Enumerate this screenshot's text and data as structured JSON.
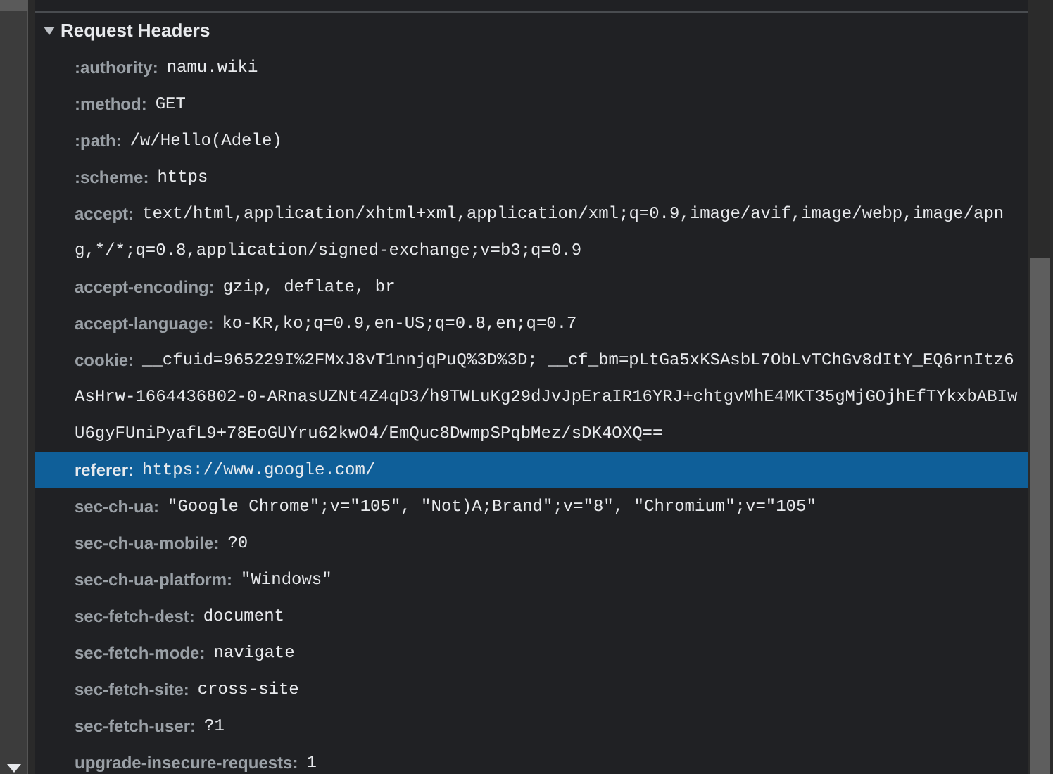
{
  "section": {
    "title": "Request Headers",
    "expanded": true,
    "headers": [
      {
        "name": ":authority:",
        "value": "namu.wiki",
        "selected": false
      },
      {
        "name": ":method:",
        "value": "GET",
        "selected": false
      },
      {
        "name": ":path:",
        "value": "/w/Hello(Adele)",
        "selected": false
      },
      {
        "name": ":scheme:",
        "value": "https",
        "selected": false
      },
      {
        "name": "accept:",
        "value": "text/html,application/xhtml+xml,application/xml;q=0.9,image/avif,image/webp,image/apng,*/*;q=0.8,application/signed-exchange;v=b3;q=0.9",
        "selected": false
      },
      {
        "name": "accept-encoding:",
        "value": "gzip, deflate, br",
        "selected": false
      },
      {
        "name": "accept-language:",
        "value": "ko-KR,ko;q=0.9,en-US;q=0.8,en;q=0.7",
        "selected": false
      },
      {
        "name": "cookie:",
        "value": "__cfuid=965229I%2FMxJ8vT1nnjqPuQ%3D%3D; __cf_bm=pLtGa5xKSAsbL7ObLvTChGv8dItY_EQ6rnItz6AsHrw-1664436802-0-ARnasUZNt4Z4qD3/h9TWLuKg29dJvJpEraIR16YRJ+chtgvMhE4MKT35gMjGOjhEfTYkxbABIwU6gyFUniPyafL9+78EoGUYru62kwO4/EmQuc8DwmpSPqbMez/sDK4OXQ==",
        "selected": false
      },
      {
        "name": "referer:",
        "value": "https://www.google.com/",
        "selected": true
      },
      {
        "name": "sec-ch-ua:",
        "value": "\"Google Chrome\";v=\"105\", \"Not)A;Brand\";v=\"8\", \"Chromium\";v=\"105\"",
        "selected": false
      },
      {
        "name": "sec-ch-ua-mobile:",
        "value": "?0",
        "selected": false
      },
      {
        "name": "sec-ch-ua-platform:",
        "value": "\"Windows\"",
        "selected": false
      },
      {
        "name": "sec-fetch-dest:",
        "value": "document",
        "selected": false
      },
      {
        "name": "sec-fetch-mode:",
        "value": "navigate",
        "selected": false
      },
      {
        "name": "sec-fetch-site:",
        "value": "cross-site",
        "selected": false
      },
      {
        "name": "sec-fetch-user:",
        "value": "?1",
        "selected": false
      },
      {
        "name": "upgrade-insecure-requests:",
        "value": "1",
        "selected": false
      }
    ]
  }
}
